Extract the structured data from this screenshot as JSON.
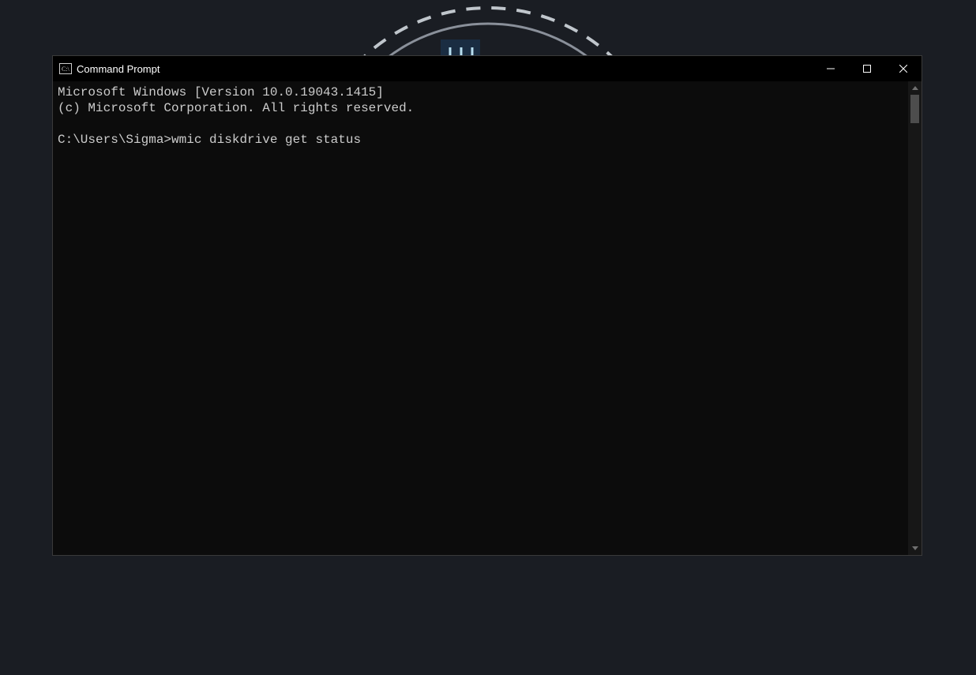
{
  "window": {
    "title": "Command Prompt"
  },
  "terminal": {
    "line1": "Microsoft Windows [Version 10.0.19043.1415]",
    "line2": "(c) Microsoft Corporation. All rights reserved.",
    "prompt": "C:\\Users\\Sigma>",
    "command": "wmic diskdrive get status"
  }
}
